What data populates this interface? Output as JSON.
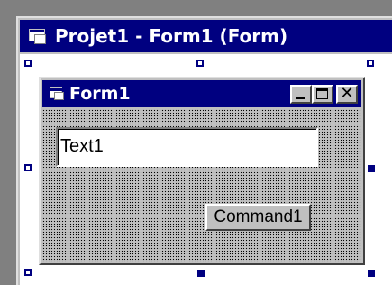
{
  "designer": {
    "title": "Projet1 - Form1 (Form)",
    "icon": "vb-form-icon"
  },
  "form": {
    "title": "Form1",
    "icon": "vb-form-icon",
    "caption_buttons": [
      "minimize-icon",
      "maximize-icon",
      "close-icon"
    ],
    "close_glyph": "✕"
  },
  "controls": {
    "textbox_value": "Text1",
    "command_label": "Command1"
  },
  "colors": {
    "title_bar": "#000080",
    "face": "#c0c0c0",
    "handle": "#000080"
  }
}
